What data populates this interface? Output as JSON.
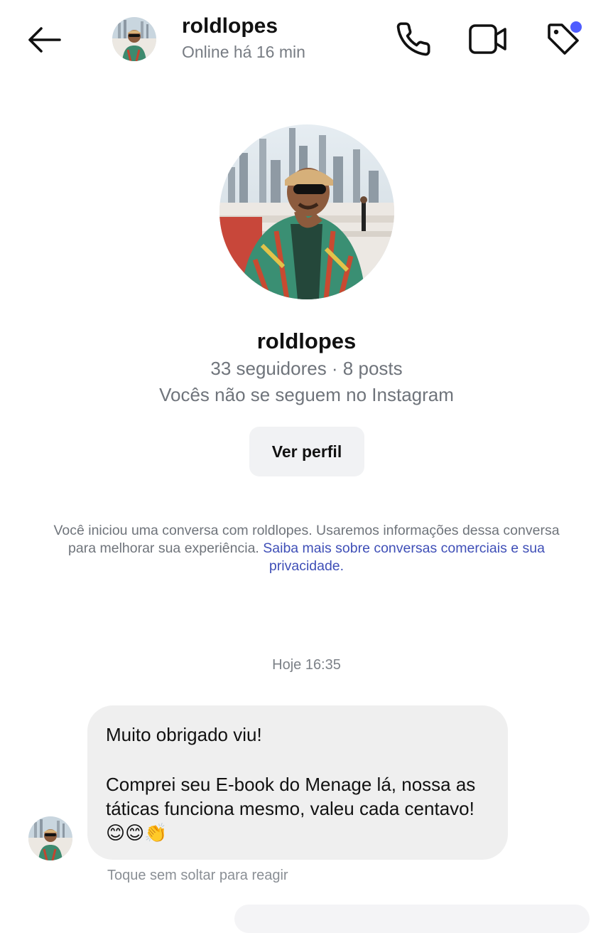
{
  "header": {
    "username": "roldlopes",
    "status": "Online há 16 min",
    "back_icon": "arrow-left-icon",
    "call_icon": "phone-icon",
    "video_icon": "video-camera-icon",
    "tag_icon": "tag-icon",
    "notification_color": "#4f5dff"
  },
  "profile": {
    "name": "roldlopes",
    "stats": "33 seguidores · 8 posts",
    "follow_status": "Vocês não se seguem no Instagram",
    "view_profile_label": "Ver perfil"
  },
  "notice": {
    "text": "Você iniciou uma conversa com roldlopes. Usaremos informações dessa conversa para melhorar sua experiência.",
    "link_text": "Saiba mais sobre conversas comerciais e sua privacidade.",
    "link_color": "#3f4fb7"
  },
  "chat": {
    "timestamp": "Hoje 16:35",
    "message": {
      "line1": "Muito obrigado viu!",
      "line2": "Comprei seu E-book do Menage lá, nossa as táticas funciona mesmo, valeu cada centavo!",
      "emojis": "😊😊👏"
    },
    "react_hint": "Toque sem soltar para reagir",
    "bubble_color": "#efefef"
  }
}
